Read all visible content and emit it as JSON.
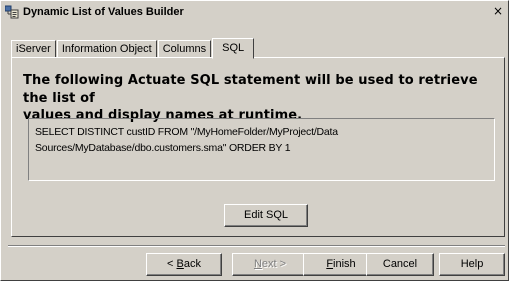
{
  "window": {
    "title": "Dynamic List of Values Builder",
    "close_glyph": "×"
  },
  "tabs": [
    {
      "label": "iServer"
    },
    {
      "label": "Information Object"
    },
    {
      "label": "Columns"
    },
    {
      "label": "SQL"
    }
  ],
  "active_tab": "SQL",
  "panel": {
    "heading_line1": "The following Actuate SQL statement will be used to retrieve the list of",
    "heading_line2": "values and display names at runtime.",
    "sql_line1": "SELECT DISTINCT custID FROM \"/MyHomeFolder/MyProject/Data",
    "sql_line2": "Sources/MyDatabase/dbo.customers.sma\" ORDER BY 1",
    "edit_sql_label": "Edit SQL"
  },
  "footer": {
    "back_prefix": "< ",
    "back_accel": "B",
    "back_rest": "ack",
    "next_accel": "N",
    "next_rest": "ext >",
    "finish_accel": "F",
    "finish_rest": "inish",
    "cancel_label": "Cancel",
    "help_label": "Help"
  },
  "icons": {
    "app": "dialog-app-icon",
    "close": "close-icon"
  }
}
